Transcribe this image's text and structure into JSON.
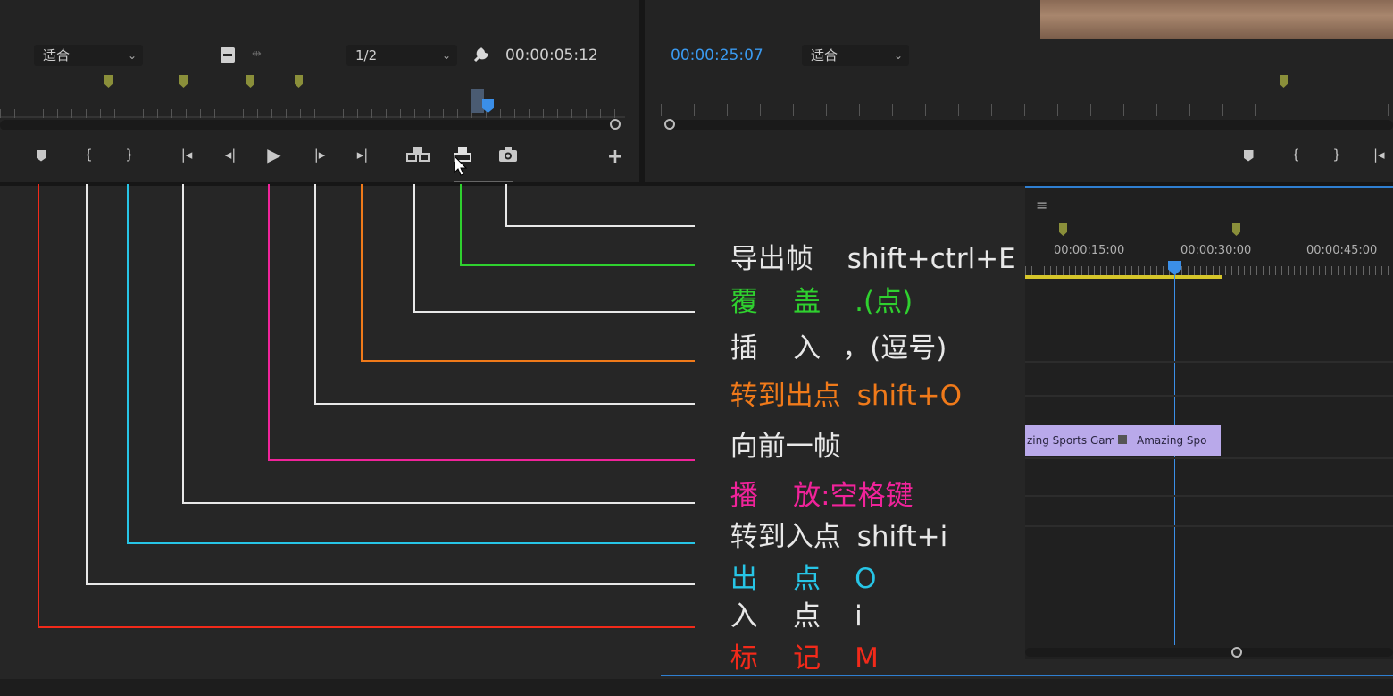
{
  "source_monitor": {
    "fit_dropdown": "适合",
    "resolution_dropdown": "1/2",
    "timecode": "00:00:05:12"
  },
  "program_monitor": {
    "timecode": "00:00:25:07",
    "fit_dropdown": "适合"
  },
  "callouts": [
    {
      "label": "导出帧",
      "shortcut": "shift+ctrl+E",
      "color": "#e8e8e8"
    },
    {
      "label": "覆    盖",
      "shortcut": ".(点)",
      "color": "#2fd12f"
    },
    {
      "label": "插    入",
      "shortcut": "，(逗号)",
      "color": "#e8e8e8"
    },
    {
      "label": "转到出点",
      "shortcut": "shift+O",
      "color": "#f07a1a"
    },
    {
      "label": "向前一帧",
      "shortcut": "",
      "color": "#e8e8e8"
    },
    {
      "label": "播    放:",
      "shortcut": "空格键",
      "color": "#f0239a"
    },
    {
      "label": "转到入点",
      "shortcut": "shift+i",
      "color": "#e8e8e8"
    },
    {
      "label": "出    点",
      "shortcut": "O",
      "color": "#27c5e6"
    },
    {
      "label": "入    点",
      "shortcut": "i",
      "color": "#e8e8e8"
    },
    {
      "label": "标    记",
      "shortcut": "M",
      "color": "#f22a1a"
    }
  ],
  "timeline": {
    "menu_icon": "≡",
    "ruler_labels": [
      "00:00:15:00",
      "00:00:30:00",
      "00:00:45:00"
    ],
    "clips": [
      "zing Sports Gam",
      "Amazing Spo"
    ]
  },
  "icons": {
    "marker": "marker-icon",
    "mark_in": "mark-in-icon",
    "mark_out": "mark-out-icon",
    "go_to_in": "go-to-in-icon",
    "step_back": "step-back-icon",
    "play": "play-icon",
    "step_forward": "step-forward-icon",
    "go_to_out": "go-to-out-icon",
    "insert": "insert-icon",
    "overwrite": "overwrite-icon",
    "export_frame": "camera-icon",
    "add": "plus-icon",
    "wrench": "wrench-icon"
  }
}
